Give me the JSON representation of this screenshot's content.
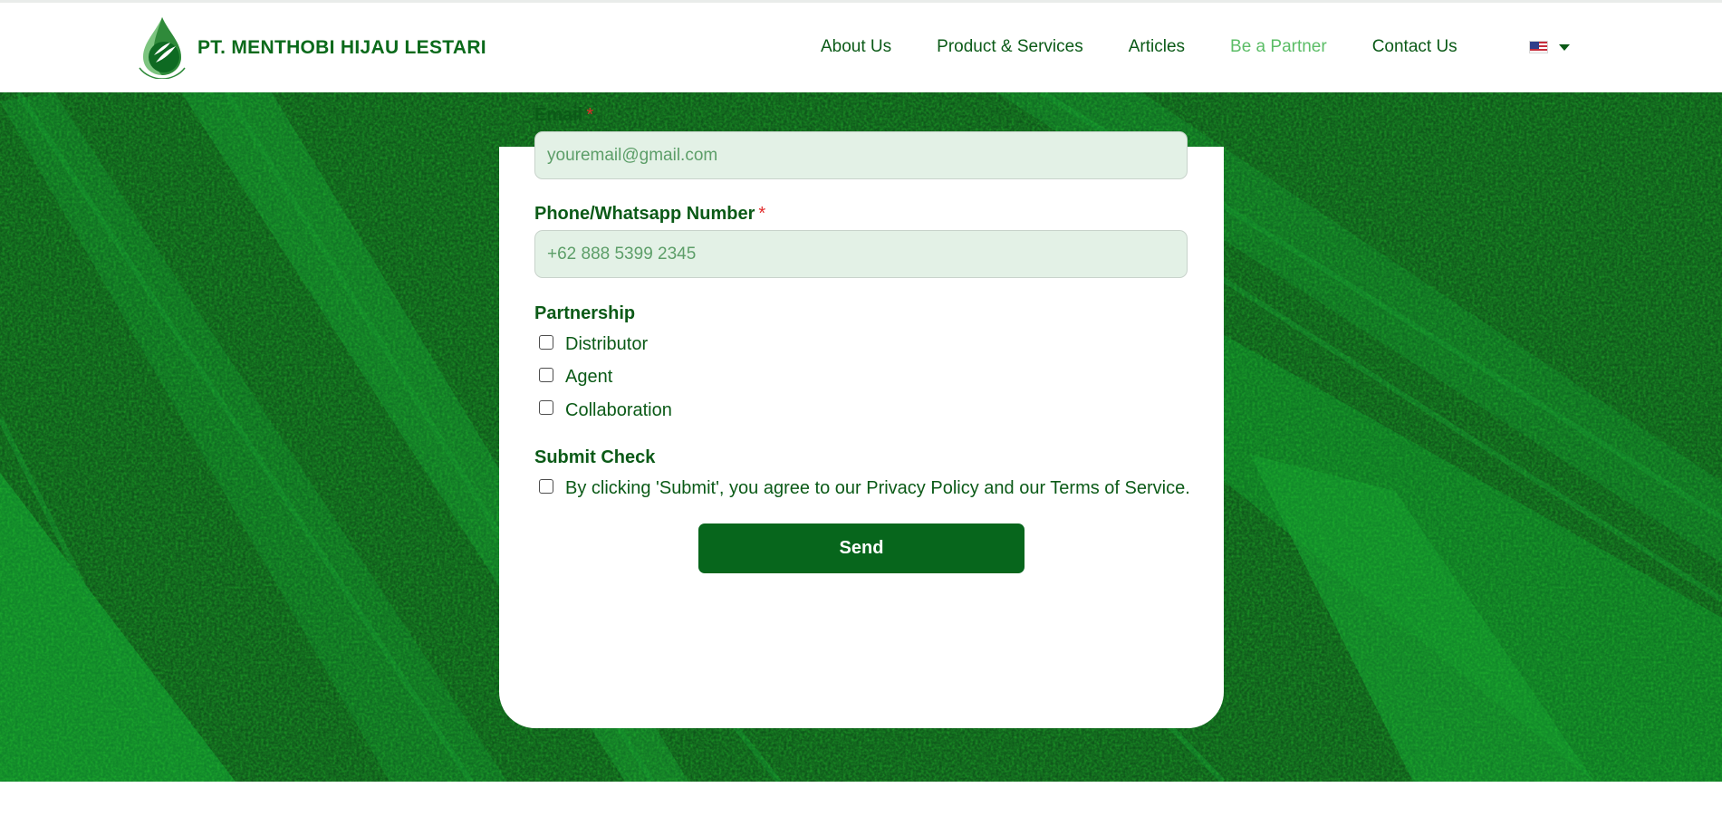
{
  "brand": {
    "name": "PT. MENTHOBI HIJAU LESTARI",
    "logo_icon": "leaf-drop-logo-icon"
  },
  "nav": {
    "items": [
      {
        "label": "About Us",
        "active": false
      },
      {
        "label": "Product & Services",
        "active": false
      },
      {
        "label": "Articles",
        "active": false
      },
      {
        "label": "Be a Partner",
        "active": true
      },
      {
        "label": "Contact Us",
        "active": false
      }
    ],
    "language_icon": "us-flag-icon"
  },
  "form": {
    "email": {
      "label": "Email",
      "required_mark": "*",
      "placeholder": "youremail@gmail.com"
    },
    "phone": {
      "label": "Phone/Whatsapp Number",
      "required_mark": "*",
      "placeholder": "+62 888 5399 2345"
    },
    "partnership": {
      "label": "Partnership",
      "options": [
        "Distributor",
        "Agent",
        "Collaboration"
      ]
    },
    "submit_check": {
      "label": "Submit Check",
      "text": "By clicking 'Submit', you agree to our Privacy Policy and our Terms of Service."
    },
    "send_label": "Send"
  },
  "colors": {
    "brand_green": "#0b6a1b",
    "active_nav": "#5bbd66",
    "button": "#07661c",
    "field_bg": "#e3f1e6",
    "required": "#e22b2b"
  }
}
